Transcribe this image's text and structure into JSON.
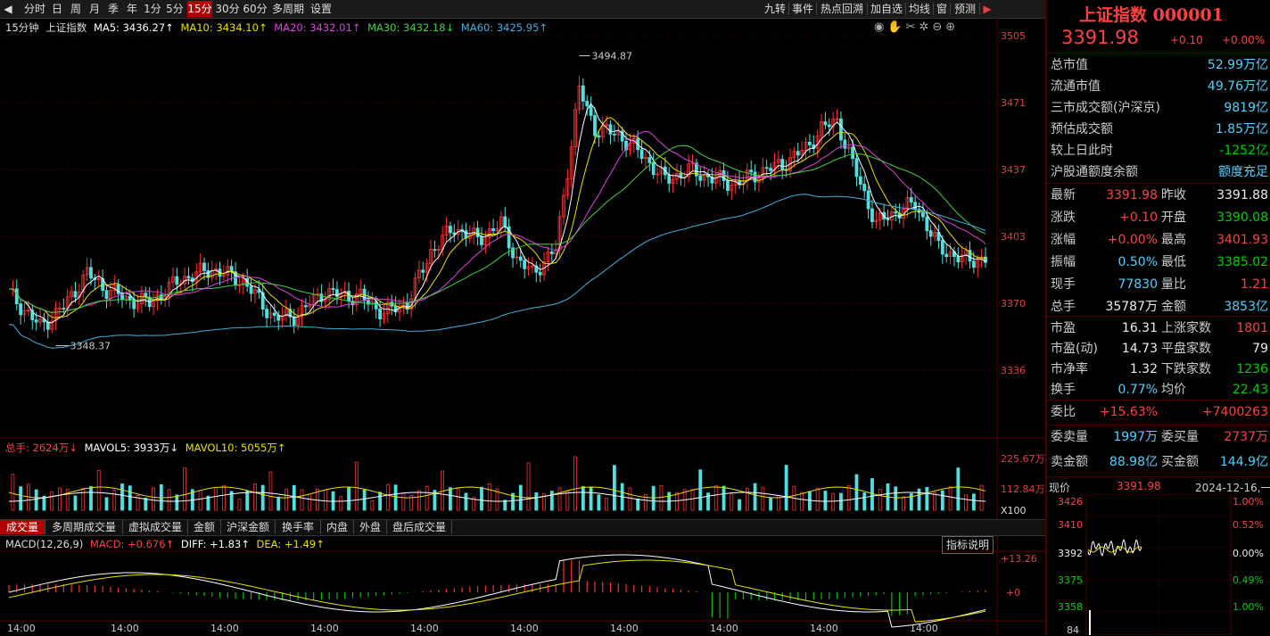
{
  "toolbar": {
    "items": [
      "分时",
      "日",
      "周",
      "月",
      "季",
      "年",
      "1分",
      "5分",
      "15分",
      "30分",
      "60分",
      "多周期",
      "设置"
    ],
    "active": "15分",
    "right_items": [
      "九转",
      "事件",
      "热点回溯",
      "加自选",
      "均线",
      "窗",
      "预测"
    ]
  },
  "legend": {
    "period": "15分钟",
    "name": "上证指数",
    "ma5": "MA5: 3436.27↑",
    "ma10": "MA10: 3434.10↑",
    "ma20": "MA20: 3432.01↑",
    "ma30": "MA30: 3432.18↓",
    "ma60": "MA60: 3425.95↑"
  },
  "price_axis": [
    "3505",
    "3471",
    "3437",
    "3403",
    "3370",
    "3336"
  ],
  "annotations": {
    "high": "3494.87",
    "low": "3348.37"
  },
  "volume": {
    "legend_total": "总手: 2624万↓",
    "legend_mavol5": "MAVOL5: 3933万↓",
    "legend_mavol10": "MAVOL10: 5055万↑",
    "axis": [
      "225.67万",
      "112.84万",
      "X100"
    ]
  },
  "tabs": [
    "成交量",
    "多周期成交量",
    "虚拟成交量",
    "金额",
    "沪深金额",
    "换手率",
    "内盘",
    "外盘",
    "盘后成交量"
  ],
  "tabs_active": "成交量",
  "macd": {
    "legend": "MACD(12,26,9)",
    "macd": "MACD: +0.676↑",
    "diff": "DIFF: +1.83↑",
    "dea": "DEA: +1.49↑",
    "axis_top": "+13.26",
    "axis_zero": "+0",
    "explain_btn": "指标说明"
  },
  "time_labels": [
    "14:00",
    "14:00",
    "14:00",
    "14:00",
    "14:00",
    "14:00",
    "14:00",
    "14:00",
    "14:00",
    "14:00"
  ],
  "colors": {
    "up": "#ff3030",
    "down": "#4fe0e0",
    "ma5": "#ffffff",
    "ma10": "#e8e000",
    "ma20": "#e040e0",
    "ma30": "#40d040",
    "ma60": "#40b0e0",
    "accent": "#b00000"
  },
  "panel": {
    "title": "上证指数 000001",
    "price": "3391.98",
    "change": "+0.10",
    "pct": "+0.00%",
    "rows1": [
      {
        "label": "总市值",
        "value": "52.99万亿"
      },
      {
        "label": "流通市值",
        "value": "49.76万亿"
      },
      {
        "label": "三市成交额(沪深京)",
        "value": "9819亿"
      },
      {
        "label": "预估成交额",
        "value": "1.85万亿"
      },
      {
        "label": "较上日此时",
        "value": "-1252亿"
      },
      {
        "label": "沪股通额度余额",
        "value": "额度充足"
      }
    ],
    "grid": [
      {
        "l1": "最新",
        "v1": "3391.98",
        "c1": "red",
        "l2": "昨收",
        "v2": "3391.88",
        "c2": "white"
      },
      {
        "l1": "涨跌",
        "v1": "+0.10",
        "c1": "red",
        "l2": "开盘",
        "v2": "3390.08",
        "c2": "green"
      },
      {
        "l1": "涨幅",
        "v1": "+0.00%",
        "c1": "red",
        "l2": "最高",
        "v2": "3401.93",
        "c2": "red"
      },
      {
        "l1": "振幅",
        "v1": "0.50%",
        "c1": "cyan",
        "l2": "最低",
        "v2": "3385.02",
        "c2": "green"
      },
      {
        "l1": "现手",
        "v1": "77830",
        "c1": "cyan",
        "l2": "量比",
        "v2": "1.21",
        "c2": "red"
      },
      {
        "l1": "总手",
        "v1": "35787万",
        "c1": "white",
        "l2": "金额",
        "v2": "3853亿",
        "c2": "cyan"
      }
    ],
    "grid2": [
      {
        "l1": "市盈",
        "v1": "16.31",
        "c1": "white",
        "l2": "上涨家数",
        "v2": "1801",
        "c2": "red"
      },
      {
        "l1": "市盈(动)",
        "v1": "14.73",
        "c1": "white",
        "l2": "平盘家数",
        "v2": "79",
        "c2": "white"
      },
      {
        "l1": "市净率",
        "v1": "1.32",
        "c1": "white",
        "l2": "下跌家数",
        "v2": "1236",
        "c2": "green"
      },
      {
        "l1": "换手",
        "v1": "0.77%",
        "c1": "cyan",
        "l2": "均价",
        "v2": "22.43",
        "c2": "green"
      }
    ],
    "weibi": {
      "label": "委比",
      "v1": "+15.63%",
      "v2": "+7400263"
    },
    "grid3": [
      {
        "l1": "委卖量",
        "v1": "1997万",
        "c1": "cyan",
        "l2": "委买量",
        "v2": "2737万",
        "c2": "red"
      },
      {
        "l1": "卖金额",
        "v1": "88.98亿",
        "c1": "cyan",
        "l2": "买金额",
        "v2": "144.9亿",
        "c2": "cyan"
      }
    ],
    "mini": {
      "label": "现价",
      "price": "3391.98",
      "date": "2024-12-16,一",
      "left_axis": [
        "3426",
        "3410",
        "3392",
        "3375",
        "3358"
      ],
      "right_axis": [
        "1.00%",
        "0.52%",
        "0.00%",
        "0.49%",
        "1.00%"
      ],
      "bottom": "84"
    }
  }
}
